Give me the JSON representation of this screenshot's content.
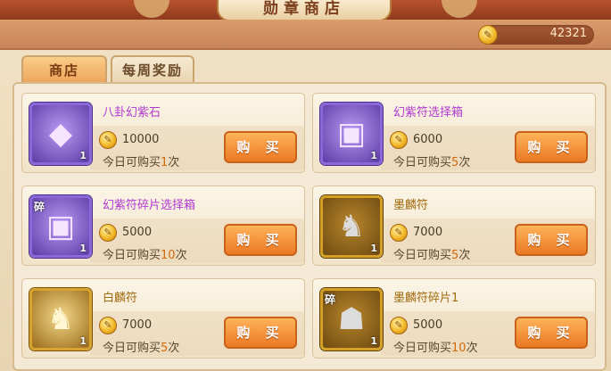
{
  "header": {
    "title": "勋章商店",
    "currency_amount": "42321",
    "currency_icon": "medal-coin-icon"
  },
  "tabs": [
    {
      "label": "商店",
      "active": true
    },
    {
      "label": "每周奖励",
      "active": false
    }
  ],
  "colors": {
    "buy_button": "#ee7f2a",
    "purple_name": "#b03ad0",
    "gold_name": "#a06a0e"
  },
  "items": [
    {
      "name": "八卦幻紫石",
      "price": "10000",
      "limit_prefix": "今日可购买",
      "limit_count": "1",
      "limit_suffix": "次",
      "quantity": "1",
      "buy_label": "购 买",
      "icon": "purple-gem-icon"
    },
    {
      "name": "幻紫符选择箱",
      "price": "6000",
      "limit_prefix": "今日可购买",
      "limit_count": "5",
      "limit_suffix": "次",
      "quantity": "1",
      "buy_label": "购 买",
      "icon": "treasure-chest-icon"
    },
    {
      "name": "幻紫符碎片选择箱",
      "price": "5000",
      "limit_prefix": "今日可购买",
      "limit_count": "10",
      "limit_suffix": "次",
      "quantity": "1",
      "buy_label": "购 买",
      "icon": "treasure-chest-icon",
      "fragment_badge": "碎"
    },
    {
      "name": "墨麟符",
      "price": "7000",
      "limit_prefix": "今日可购买",
      "limit_count": "5",
      "limit_suffix": "次",
      "quantity": "1",
      "buy_label": "购 买",
      "icon": "qilin-statue-icon"
    },
    {
      "name": "白麟符",
      "price": "7000",
      "limit_prefix": "今日可购买",
      "limit_count": "5",
      "limit_suffix": "次",
      "quantity": "1",
      "buy_label": "购 买",
      "icon": "qilin-statue-icon"
    },
    {
      "name": "墨麟符碎片1",
      "price": "5000",
      "limit_prefix": "今日可购买",
      "limit_count": "10",
      "limit_suffix": "次",
      "quantity": "1",
      "buy_label": "购 买",
      "icon": "qilin-head-icon",
      "fragment_badge": "碎"
    }
  ]
}
